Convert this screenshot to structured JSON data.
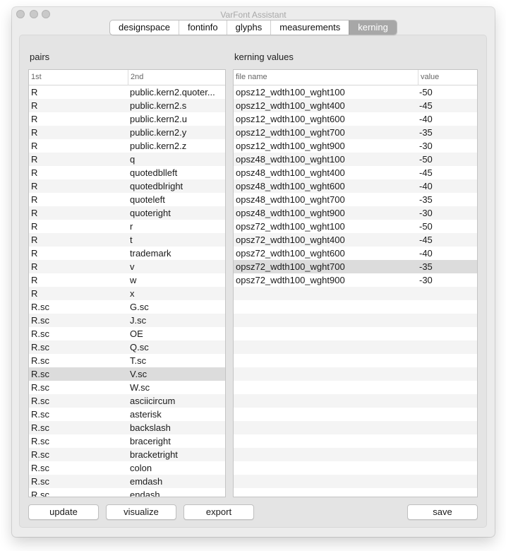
{
  "window": {
    "title": "VarFont Assistant"
  },
  "tabs": [
    {
      "label": "designspace"
    },
    {
      "label": "fontinfo"
    },
    {
      "label": "glyphs"
    },
    {
      "label": "measurements"
    },
    {
      "label": "kerning"
    }
  ],
  "active_tab": "kerning",
  "pairs": {
    "label": "pairs",
    "columns": [
      "1st",
      "2nd"
    ],
    "selected_index": 21,
    "rows": [
      [
        "R",
        "public.kern2.quoter..."
      ],
      [
        "R",
        "public.kern2.s"
      ],
      [
        "R",
        "public.kern2.u"
      ],
      [
        "R",
        "public.kern2.y"
      ],
      [
        "R",
        "public.kern2.z"
      ],
      [
        "R",
        "q"
      ],
      [
        "R",
        "quotedblleft"
      ],
      [
        "R",
        "quotedblright"
      ],
      [
        "R",
        "quoteleft"
      ],
      [
        "R",
        "quoteright"
      ],
      [
        "R",
        "r"
      ],
      [
        "R",
        "t"
      ],
      [
        "R",
        "trademark"
      ],
      [
        "R",
        "v"
      ],
      [
        "R",
        "w"
      ],
      [
        "R",
        "x"
      ],
      [
        "R.sc",
        "G.sc"
      ],
      [
        "R.sc",
        "J.sc"
      ],
      [
        "R.sc",
        "OE"
      ],
      [
        "R.sc",
        "Q.sc"
      ],
      [
        "R.sc",
        "T.sc"
      ],
      [
        "R.sc",
        "V.sc"
      ],
      [
        "R.sc",
        "W.sc"
      ],
      [
        "R.sc",
        "asciicircum"
      ],
      [
        "R.sc",
        "asterisk"
      ],
      [
        "R.sc",
        "backslash"
      ],
      [
        "R.sc",
        "braceright"
      ],
      [
        "R.sc",
        "bracketright"
      ],
      [
        "R.sc",
        "colon"
      ],
      [
        "R.sc",
        "emdash"
      ],
      [
        "R.sc",
        "endash"
      ]
    ]
  },
  "kerning": {
    "label": "kerning values",
    "columns": [
      "file name",
      "value"
    ],
    "selected_index": 13,
    "rows": [
      [
        "opsz12_wdth100_wght100",
        "-50"
      ],
      [
        "opsz12_wdth100_wght400",
        "-45"
      ],
      [
        "opsz12_wdth100_wght600",
        "-40"
      ],
      [
        "opsz12_wdth100_wght700",
        "-35"
      ],
      [
        "opsz12_wdth100_wght900",
        "-30"
      ],
      [
        "opsz48_wdth100_wght100",
        "-50"
      ],
      [
        "opsz48_wdth100_wght400",
        "-45"
      ],
      [
        "opsz48_wdth100_wght600",
        "-40"
      ],
      [
        "opsz48_wdth100_wght700",
        "-35"
      ],
      [
        "opsz48_wdth100_wght900",
        "-30"
      ],
      [
        "opsz72_wdth100_wght100",
        "-50"
      ],
      [
        "opsz72_wdth100_wght400",
        "-45"
      ],
      [
        "opsz72_wdth100_wght600",
        "-40"
      ],
      [
        "opsz72_wdth100_wght700",
        "-35"
      ],
      [
        "opsz72_wdth100_wght900",
        "-30"
      ]
    ]
  },
  "buttons": {
    "update": "update",
    "visualize": "visualize",
    "export": "export",
    "save": "save"
  }
}
